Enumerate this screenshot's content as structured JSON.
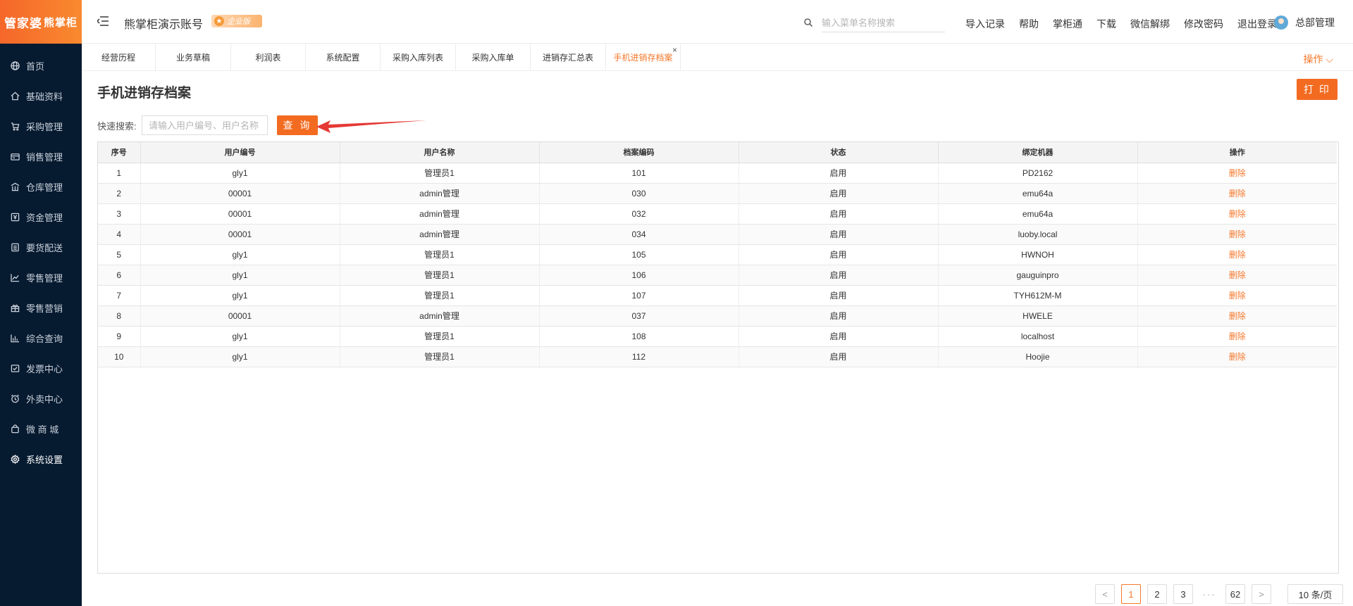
{
  "sidebar": {
    "logo_main": "管家婆",
    "logo_sub": "熊掌柜",
    "items": [
      {
        "label": "首页",
        "icon": "globe-icon"
      },
      {
        "label": "基础资料",
        "icon": "home-icon"
      },
      {
        "label": "采购管理",
        "icon": "cart-icon"
      },
      {
        "label": "销售管理",
        "icon": "card-icon"
      },
      {
        "label": "仓库管理",
        "icon": "warehouse-icon"
      },
      {
        "label": "资金管理",
        "icon": "money-icon"
      },
      {
        "label": "要货配送",
        "icon": "list-icon"
      },
      {
        "label": "零售管理",
        "icon": "chart-icon"
      },
      {
        "label": "零售营销",
        "icon": "gift-icon"
      },
      {
        "label": "综合查询",
        "icon": "bar-chart-icon"
      },
      {
        "label": "发票中心",
        "icon": "invoice-icon"
      },
      {
        "label": "外卖中心",
        "icon": "alarm-icon"
      },
      {
        "label": "微 商 城",
        "icon": "bag-icon"
      },
      {
        "label": "系统设置",
        "icon": "gear-icon"
      }
    ]
  },
  "header": {
    "account": "熊掌柜演示账号",
    "badge": "企业版",
    "search_placeholder": "输入菜单名称搜索",
    "links": [
      "导入记录",
      "帮助",
      "掌柜通",
      "下载",
      "微信解绑",
      "修改密码",
      "退出登录"
    ],
    "user": "总部管理"
  },
  "tabs": {
    "items": [
      "经营历程",
      "业务草稿",
      "利润表",
      "系统配置",
      "采购入库列表",
      "采购入库单",
      "进销存汇总表",
      "手机进销存档案"
    ],
    "active_index": 7,
    "ops_label": "操作"
  },
  "page": {
    "title": "手机进销存档案",
    "print_label": "打 印",
    "quick_search_label": "快速搜索:",
    "quick_search_placeholder": "请输入用户编号、用户名称",
    "query_label": "查 询"
  },
  "table": {
    "headers": [
      "序号",
      "用户编号",
      "用户名称",
      "档案编码",
      "状态",
      "绑定机器",
      "操作"
    ],
    "rows": [
      [
        "1",
        "gly1",
        "管理员1",
        "101",
        "启用",
        "PD2162",
        "删除"
      ],
      [
        "2",
        "00001",
        "admin管理",
        "030",
        "启用",
        "emu64a",
        "删除"
      ],
      [
        "3",
        "00001",
        "admin管理",
        "032",
        "启用",
        "emu64a",
        "删除"
      ],
      [
        "4",
        "00001",
        "admin管理",
        "034",
        "启用",
        "luoby.local",
        "删除"
      ],
      [
        "5",
        "gly1",
        "管理员1",
        "105",
        "启用",
        "HWNOH",
        "删除"
      ],
      [
        "6",
        "gly1",
        "管理员1",
        "106",
        "启用",
        "gauguinpro",
        "删除"
      ],
      [
        "7",
        "gly1",
        "管理员1",
        "107",
        "启用",
        "TYH612M-M",
        "删除"
      ],
      [
        "8",
        "00001",
        "admin管理",
        "037",
        "启用",
        "HWELE",
        "删除"
      ],
      [
        "9",
        "gly1",
        "管理员1",
        "108",
        "启用",
        "localhost",
        "删除"
      ],
      [
        "10",
        "gly1",
        "管理员1",
        "112",
        "启用",
        "Hoojie",
        "删除"
      ]
    ]
  },
  "pagination": {
    "prev": "<",
    "pages": [
      "1",
      "2",
      "3"
    ],
    "dots": "···",
    "last": "62",
    "next": ">",
    "current": "1",
    "page_size": "10 条/页"
  },
  "colors": {
    "accent": "#f36b21",
    "sidebar_bg": "#061a30",
    "annotation_arrow": "#e53935"
  }
}
